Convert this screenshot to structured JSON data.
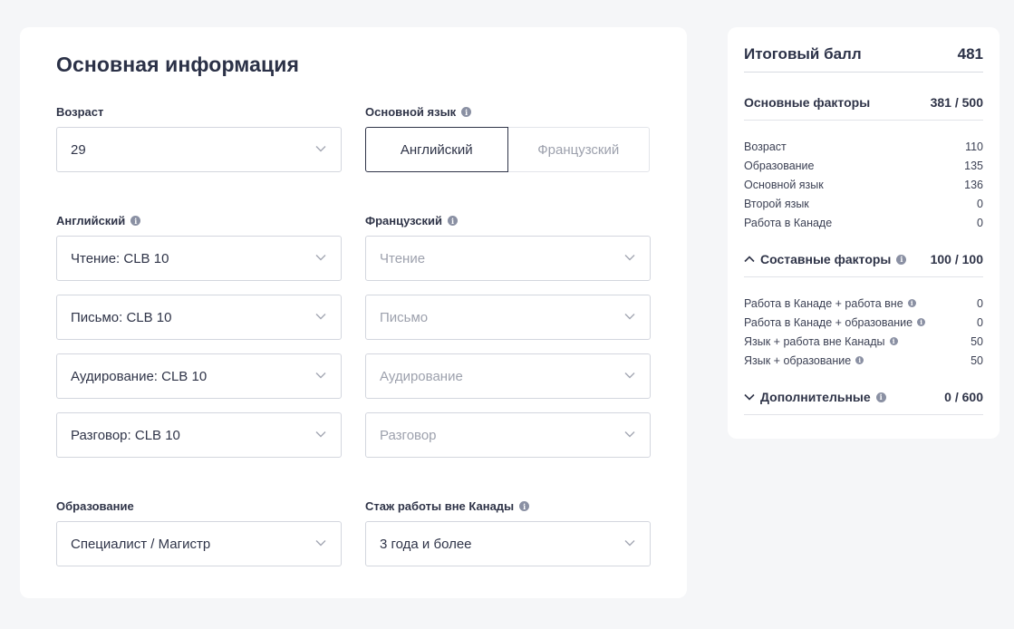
{
  "main": {
    "title": "Основная информация",
    "age": {
      "label": "Возраст",
      "value": "29"
    },
    "primary_language": {
      "label": "Основной язык",
      "options": [
        "Английский",
        "Французский"
      ],
      "selected": "Английский"
    },
    "english": {
      "label": "Английский",
      "reading": "Чтение: CLB 10",
      "writing": "Письмо: CLB 10",
      "listening": "Аудирование: CLB 10",
      "speaking": "Разговор: CLB 10"
    },
    "french": {
      "label": "Французский",
      "reading_placeholder": "Чтение",
      "writing_placeholder": "Письмо",
      "listening_placeholder": "Аудирование",
      "speaking_placeholder": "Разговор"
    },
    "education": {
      "label": "Образование",
      "value": "Специалист / Магистр"
    },
    "foreign_experience": {
      "label": "Стаж работы вне Канады",
      "value": "3 года и более"
    }
  },
  "summary": {
    "total_label": "Итоговый балл",
    "total_value": "481",
    "core": {
      "label": "Основные факторы",
      "value": "381 / 500",
      "rows": [
        {
          "label": "Возраст",
          "value": "110"
        },
        {
          "label": "Образование",
          "value": "135"
        },
        {
          "label": "Основной язык",
          "value": "136"
        },
        {
          "label": "Второй язык",
          "value": "0"
        },
        {
          "label": "Работа в Канаде",
          "value": "0"
        }
      ]
    },
    "combined": {
      "label": "Составные факторы",
      "value": "100 / 100",
      "expanded": true,
      "rows": [
        {
          "label": "Работа в Канаде + работа вне",
          "value": "0"
        },
        {
          "label": "Работа в Канаде + образование",
          "value": "0"
        },
        {
          "label": "Язык + работа вне Канады",
          "value": "50"
        },
        {
          "label": "Язык + образование",
          "value": "50"
        }
      ]
    },
    "additional": {
      "label": "Дополнительные",
      "value": "0 / 600",
      "expanded": false
    }
  },
  "colors": {
    "text": "#2f3448",
    "border": "#d3d6de",
    "placeholder": "#9da1ad",
    "info_icon": "#8a90a3",
    "background": "#f5f6f8"
  },
  "icons": {
    "dropdown": "chevron-down-icon",
    "info": "info-icon",
    "collapse": "chevron-up-icon",
    "expand": "chevron-down-icon"
  }
}
